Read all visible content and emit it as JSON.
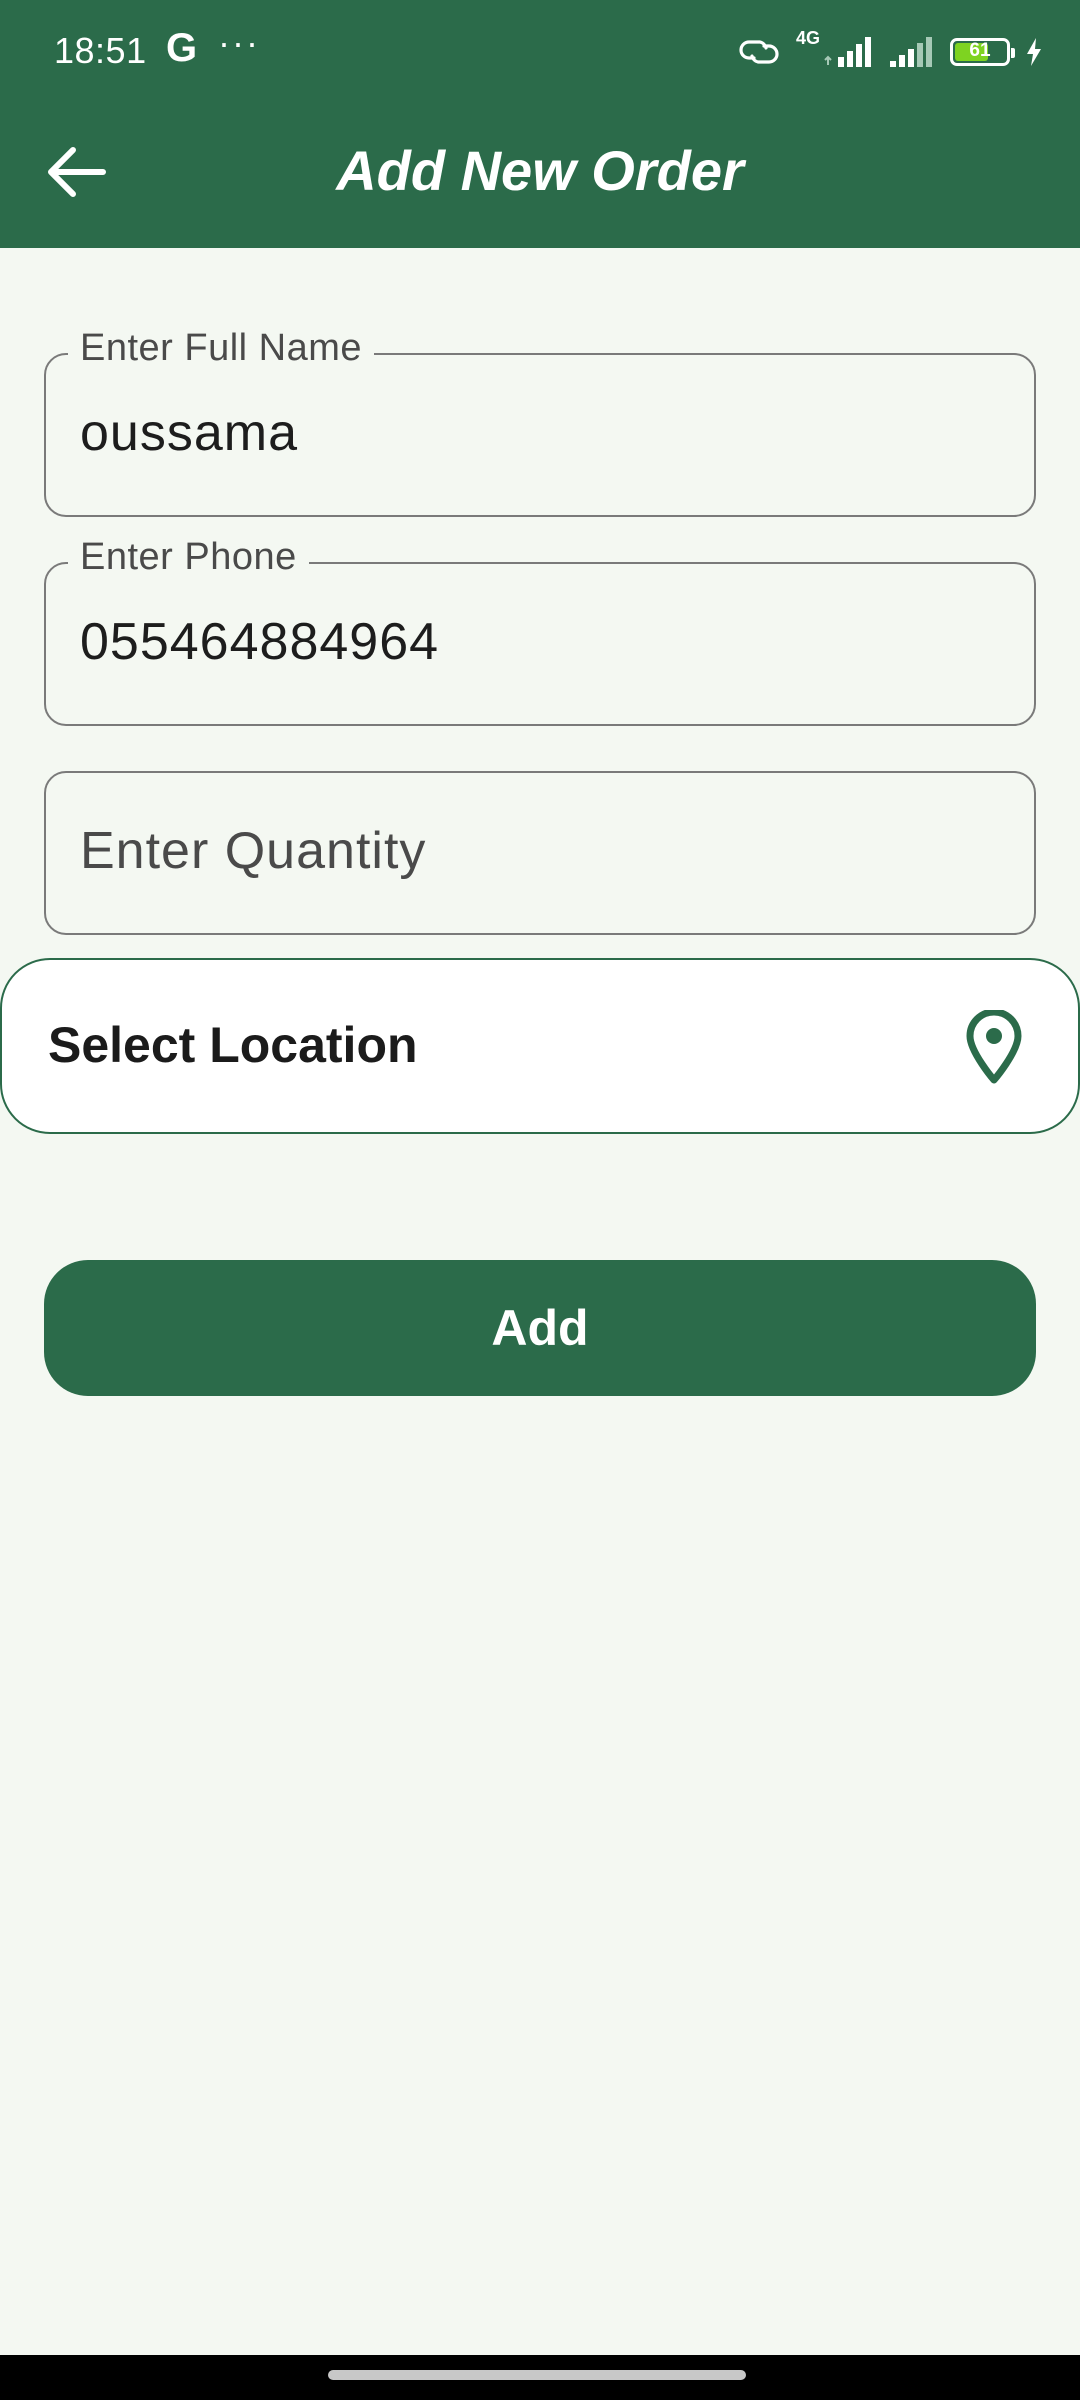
{
  "status_bar": {
    "time": "18:51",
    "google_glyph": "G",
    "more_glyph": "···",
    "network_type": "4G",
    "battery_level": "61",
    "icons": [
      "hotspot-link-icon",
      "signal-4g-icon",
      "signal-icon",
      "battery-icon",
      "charging-bolt-icon"
    ]
  },
  "app_bar": {
    "title": "Add New Order",
    "back_icon": "arrow-left-icon"
  },
  "form": {
    "full_name": {
      "label": "Enter Full Name",
      "value": "oussama"
    },
    "phone": {
      "label": "Enter Phone",
      "value": "055464884964"
    },
    "quantity": {
      "placeholder": "Enter Quantity",
      "value": ""
    },
    "location": {
      "label": "Select Location",
      "icon": "map-pin-icon"
    },
    "submit_label": "Add"
  },
  "colors": {
    "primary": "#2b6b4a",
    "background": "#f4f8f2",
    "field_border": "#7a7a7a",
    "battery_fill": "#7ed321"
  }
}
